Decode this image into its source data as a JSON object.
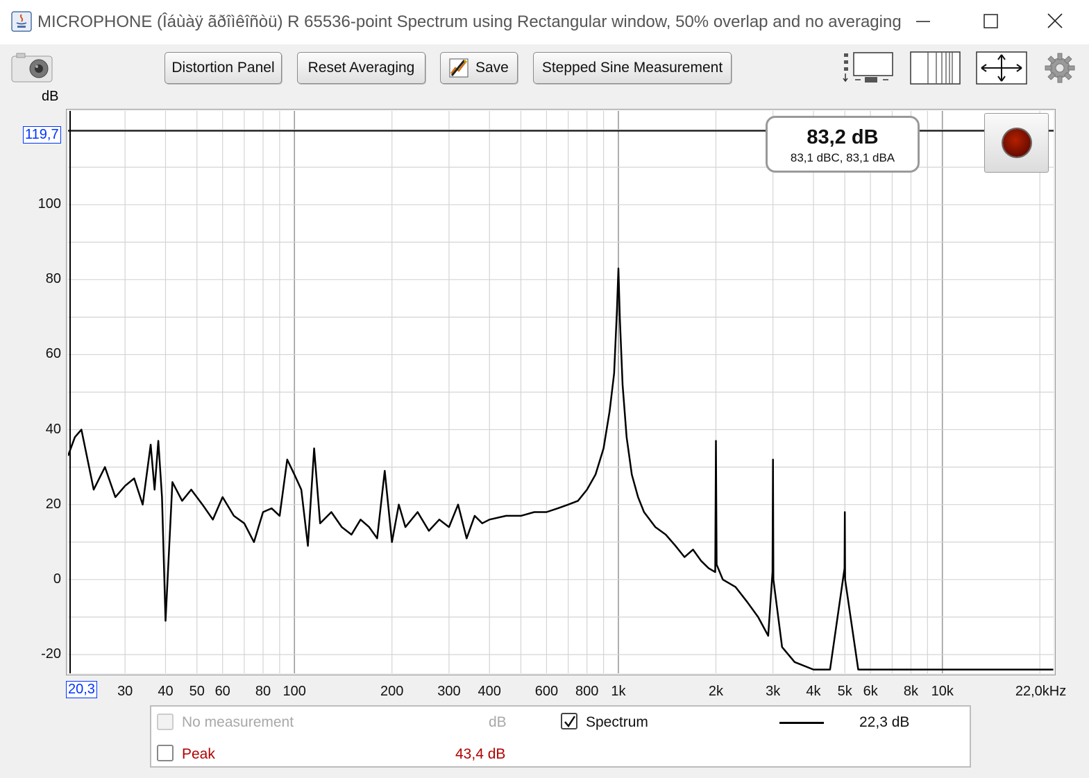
{
  "window": {
    "title": "MICROPHONE (Îáùàÿ ãðîìêîñòü) R 65536-point Spectrum using Rectangular window, 50% overlap and no averaging"
  },
  "toolbar": {
    "distortion_label": "Distortion Panel",
    "reset_label": "Reset Averaging",
    "save_label": "Save",
    "stepped_label": "Stepped Sine Measurement"
  },
  "readout": {
    "level": "83,2 dB",
    "weighted": "83,1 dBC, 83,1 dBA"
  },
  "axes": {
    "y_unit": "dB",
    "y_cursor": "119,7",
    "x_cursor": "20,3",
    "y_ticks": [
      "100",
      "80",
      "60",
      "40",
      "20",
      "0",
      "-20"
    ],
    "x_ticks": [
      "30",
      "40",
      "50",
      "60",
      "80",
      "100",
      "200",
      "300",
      "400",
      "600",
      "800",
      "1k",
      "2k",
      "3k",
      "4k",
      "5k",
      "6k",
      "8k",
      "10k",
      "22,0kHz"
    ]
  },
  "legend": {
    "row1_label": "No measurement",
    "row1_unit": "dB",
    "row2_label": "Peak",
    "row2_value": "43,4 dB",
    "series_label": "Spectrum",
    "series_value": "22,3 dB",
    "series_checked": true
  },
  "colors": {
    "peak": "#b00000",
    "cursor_label": "#0033ff",
    "trace": "#000000",
    "record": "#8b1500"
  },
  "chart_data": {
    "type": "line",
    "title": "",
    "xlabel": "",
    "ylabel": "dB",
    "x_scale": "log",
    "xlim": [
      20,
      22050
    ],
    "ylim": [
      -25,
      125
    ],
    "grid": true,
    "cursor": {
      "x": 20.3,
      "y": 119.7
    },
    "series": [
      {
        "name": "Spectrum",
        "x": [
          20,
          21,
          22,
          24,
          26,
          28,
          30,
          32,
          34,
          36,
          37,
          38,
          39,
          40,
          42,
          45,
          48,
          52,
          56,
          60,
          65,
          70,
          75,
          80,
          85,
          90,
          95,
          100,
          105,
          110,
          115,
          120,
          130,
          140,
          150,
          160,
          170,
          180,
          190,
          200,
          210,
          220,
          240,
          260,
          280,
          300,
          320,
          340,
          360,
          380,
          400,
          450,
          500,
          550,
          600,
          650,
          700,
          750,
          800,
          850,
          900,
          940,
          970,
          990,
          1000,
          1010,
          1030,
          1060,
          1100,
          1150,
          1200,
          1300,
          1400,
          1500,
          1600,
          1700,
          1800,
          1900,
          1990,
          2000,
          2010,
          2100,
          2300,
          2500,
          2700,
          2900,
          2990,
          3000,
          3010,
          3200,
          3500,
          4000,
          4500,
          4990,
          5000,
          5010,
          5500,
          6000,
          7000,
          8000,
          9000,
          10000,
          12000,
          14000,
          16000,
          18000,
          20000,
          22000
        ],
        "y": [
          33,
          38,
          40,
          24,
          30,
          22,
          25,
          27,
          20,
          36,
          24,
          37,
          22,
          -11,
          26,
          21,
          24,
          20,
          16,
          22,
          17,
          15,
          10,
          18,
          19,
          17,
          32,
          28,
          24,
          9,
          35,
          15,
          18,
          14,
          12,
          16,
          14,
          11,
          29,
          10,
          20,
          14,
          18,
          13,
          16,
          14,
          20,
          11,
          17,
          15,
          16,
          17,
          17,
          18,
          18,
          19,
          20,
          21,
          24,
          28,
          35,
          45,
          55,
          72,
          83,
          70,
          52,
          38,
          28,
          22,
          18,
          14,
          12,
          9,
          6,
          8,
          5,
          3,
          2,
          37,
          4,
          0,
          -2,
          -6,
          -10,
          -15,
          2,
          32,
          0,
          -18,
          -22,
          -24,
          -24,
          3,
          18,
          0,
          -24,
          -24,
          -24,
          -24,
          -24,
          -24,
          -24,
          -24,
          -24,
          -24,
          -24,
          -24
        ]
      }
    ]
  }
}
